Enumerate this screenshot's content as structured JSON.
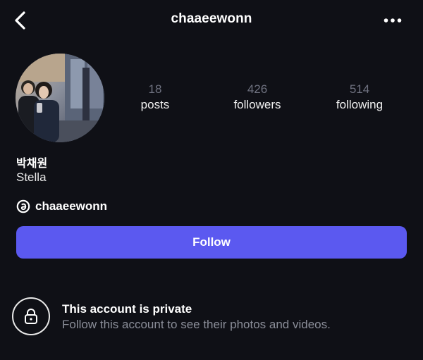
{
  "header": {
    "title": "chaaeewonn",
    "back_icon": "chevron-left-icon",
    "more_icon": "more-horizontal-icon"
  },
  "profile": {
    "avatar_description": "profile-photo",
    "display_name": "박채원",
    "bio_name": "Stella",
    "threads_handle": "chaaeewonn"
  },
  "stats": {
    "posts": {
      "count": "18",
      "label": "posts"
    },
    "followers": {
      "count": "426",
      "label": "followers"
    },
    "following": {
      "count": "514",
      "label": "following"
    }
  },
  "actions": {
    "follow_label": "Follow",
    "follow_color": "#5b59f0"
  },
  "private_notice": {
    "title": "This account is private",
    "subtitle": "Follow this account to see their photos and videos."
  },
  "colors": {
    "background": "#0f1016",
    "muted_text": "#8b8e99",
    "stat_number": "#6f7280"
  }
}
